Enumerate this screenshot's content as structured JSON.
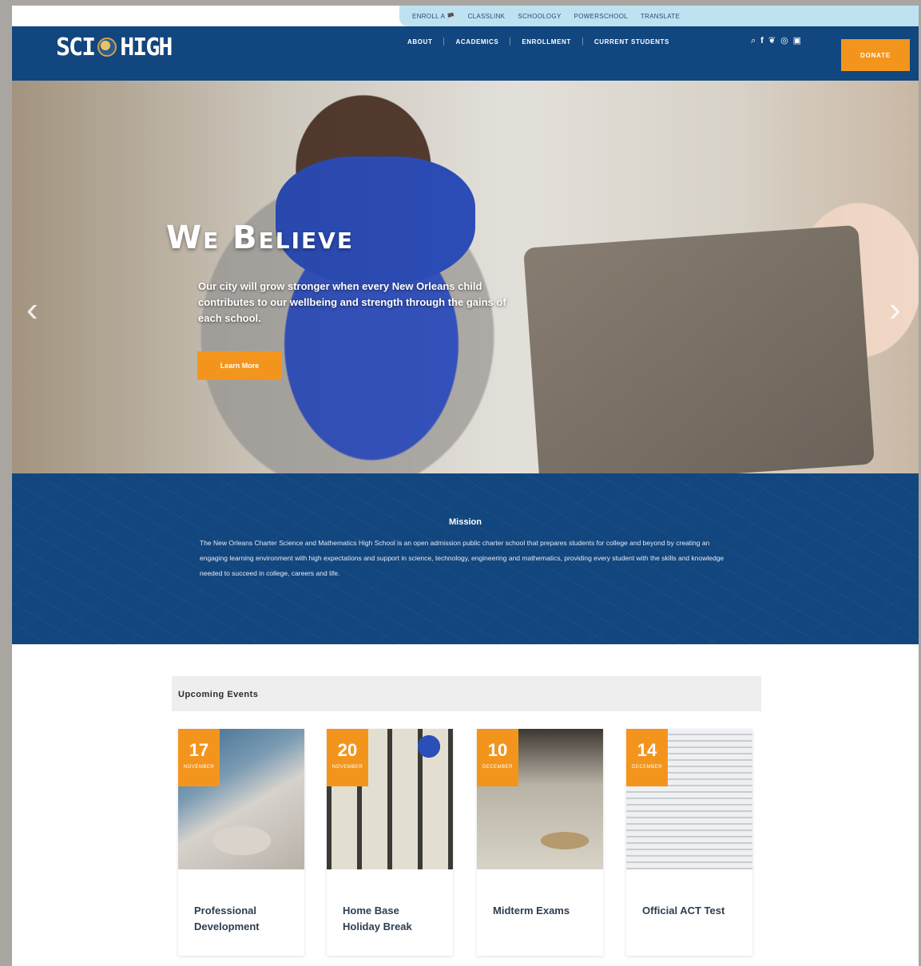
{
  "utility_bar": {
    "links": [
      "ENROLL A 🏴",
      "CLASSLINK",
      "SCHOOLOGY",
      "POWERSCHOOL",
      "TRANSLATE"
    ]
  },
  "header": {
    "logo_left": "SCI",
    "logo_right": "HIGH",
    "nav": [
      "ABOUT",
      "ACADEMICS",
      "ENROLLMENT",
      "CURRENT STUDENTS"
    ],
    "icons": [
      "search-icon",
      "facebook-icon",
      "twitter-icon",
      "instagram-icon",
      "linkedin-icon"
    ],
    "donate_label": "DONATE"
  },
  "hero": {
    "heading": "We Believe",
    "text": "Our city will grow stronger when every New Orleans child contributes to our wellbeing and strength through the gains of each school.",
    "button_label": "Learn More",
    "prev_arrow": "‹",
    "next_arrow": "›"
  },
  "mission": {
    "heading": "Mission",
    "text": "The New Orleans Charter Science and Mathematics High School is an open admission public charter school that prepares students for college and beyond by creating an engaging learning environment with high expectations and support in science, technology, engineering and mathematics, providing every student with the skills and knowledge needed to succeed in college, careers and life."
  },
  "events": {
    "heading": "Upcoming Events",
    "items": [
      {
        "day": "17",
        "month": "NOVEMBER",
        "title": "Professional Development"
      },
      {
        "day": "20",
        "month": "NOVEMBER",
        "title": "Home Base Holiday Break"
      },
      {
        "day": "10",
        "month": "DECEMBER",
        "title": "Midterm Exams"
      },
      {
        "day": "14",
        "month": "DECEMBER",
        "title": "Official ACT Test"
      }
    ]
  },
  "colors": {
    "navy": "#12467e",
    "orange": "#f3951d",
    "light_blue": "#bfe2f1"
  }
}
